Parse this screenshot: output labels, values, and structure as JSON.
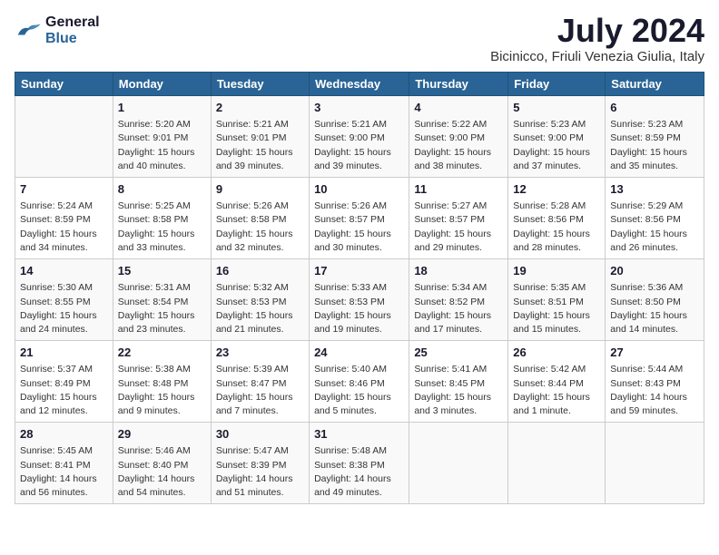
{
  "header": {
    "logo_line1": "General",
    "logo_line2": "Blue",
    "month": "July 2024",
    "location": "Bicinicco, Friuli Venezia Giulia, Italy"
  },
  "days_of_week": [
    "Sunday",
    "Monday",
    "Tuesday",
    "Wednesday",
    "Thursday",
    "Friday",
    "Saturday"
  ],
  "weeks": [
    [
      {
        "day": "",
        "info": ""
      },
      {
        "day": "1",
        "info": "Sunrise: 5:20 AM\nSunset: 9:01 PM\nDaylight: 15 hours\nand 40 minutes."
      },
      {
        "day": "2",
        "info": "Sunrise: 5:21 AM\nSunset: 9:01 PM\nDaylight: 15 hours\nand 39 minutes."
      },
      {
        "day": "3",
        "info": "Sunrise: 5:21 AM\nSunset: 9:00 PM\nDaylight: 15 hours\nand 39 minutes."
      },
      {
        "day": "4",
        "info": "Sunrise: 5:22 AM\nSunset: 9:00 PM\nDaylight: 15 hours\nand 38 minutes."
      },
      {
        "day": "5",
        "info": "Sunrise: 5:23 AM\nSunset: 9:00 PM\nDaylight: 15 hours\nand 37 minutes."
      },
      {
        "day": "6",
        "info": "Sunrise: 5:23 AM\nSunset: 8:59 PM\nDaylight: 15 hours\nand 35 minutes."
      }
    ],
    [
      {
        "day": "7",
        "info": "Sunrise: 5:24 AM\nSunset: 8:59 PM\nDaylight: 15 hours\nand 34 minutes."
      },
      {
        "day": "8",
        "info": "Sunrise: 5:25 AM\nSunset: 8:58 PM\nDaylight: 15 hours\nand 33 minutes."
      },
      {
        "day": "9",
        "info": "Sunrise: 5:26 AM\nSunset: 8:58 PM\nDaylight: 15 hours\nand 32 minutes."
      },
      {
        "day": "10",
        "info": "Sunrise: 5:26 AM\nSunset: 8:57 PM\nDaylight: 15 hours\nand 30 minutes."
      },
      {
        "day": "11",
        "info": "Sunrise: 5:27 AM\nSunset: 8:57 PM\nDaylight: 15 hours\nand 29 minutes."
      },
      {
        "day": "12",
        "info": "Sunrise: 5:28 AM\nSunset: 8:56 PM\nDaylight: 15 hours\nand 28 minutes."
      },
      {
        "day": "13",
        "info": "Sunrise: 5:29 AM\nSunset: 8:56 PM\nDaylight: 15 hours\nand 26 minutes."
      }
    ],
    [
      {
        "day": "14",
        "info": "Sunrise: 5:30 AM\nSunset: 8:55 PM\nDaylight: 15 hours\nand 24 minutes."
      },
      {
        "day": "15",
        "info": "Sunrise: 5:31 AM\nSunset: 8:54 PM\nDaylight: 15 hours\nand 23 minutes."
      },
      {
        "day": "16",
        "info": "Sunrise: 5:32 AM\nSunset: 8:53 PM\nDaylight: 15 hours\nand 21 minutes."
      },
      {
        "day": "17",
        "info": "Sunrise: 5:33 AM\nSunset: 8:53 PM\nDaylight: 15 hours\nand 19 minutes."
      },
      {
        "day": "18",
        "info": "Sunrise: 5:34 AM\nSunset: 8:52 PM\nDaylight: 15 hours\nand 17 minutes."
      },
      {
        "day": "19",
        "info": "Sunrise: 5:35 AM\nSunset: 8:51 PM\nDaylight: 15 hours\nand 15 minutes."
      },
      {
        "day": "20",
        "info": "Sunrise: 5:36 AM\nSunset: 8:50 PM\nDaylight: 15 hours\nand 14 minutes."
      }
    ],
    [
      {
        "day": "21",
        "info": "Sunrise: 5:37 AM\nSunset: 8:49 PM\nDaylight: 15 hours\nand 12 minutes."
      },
      {
        "day": "22",
        "info": "Sunrise: 5:38 AM\nSunset: 8:48 PM\nDaylight: 15 hours\nand 9 minutes."
      },
      {
        "day": "23",
        "info": "Sunrise: 5:39 AM\nSunset: 8:47 PM\nDaylight: 15 hours\nand 7 minutes."
      },
      {
        "day": "24",
        "info": "Sunrise: 5:40 AM\nSunset: 8:46 PM\nDaylight: 15 hours\nand 5 minutes."
      },
      {
        "day": "25",
        "info": "Sunrise: 5:41 AM\nSunset: 8:45 PM\nDaylight: 15 hours\nand 3 minutes."
      },
      {
        "day": "26",
        "info": "Sunrise: 5:42 AM\nSunset: 8:44 PM\nDaylight: 15 hours\nand 1 minute."
      },
      {
        "day": "27",
        "info": "Sunrise: 5:44 AM\nSunset: 8:43 PM\nDaylight: 14 hours\nand 59 minutes."
      }
    ],
    [
      {
        "day": "28",
        "info": "Sunrise: 5:45 AM\nSunset: 8:41 PM\nDaylight: 14 hours\nand 56 minutes."
      },
      {
        "day": "29",
        "info": "Sunrise: 5:46 AM\nSunset: 8:40 PM\nDaylight: 14 hours\nand 54 minutes."
      },
      {
        "day": "30",
        "info": "Sunrise: 5:47 AM\nSunset: 8:39 PM\nDaylight: 14 hours\nand 51 minutes."
      },
      {
        "day": "31",
        "info": "Sunrise: 5:48 AM\nSunset: 8:38 PM\nDaylight: 14 hours\nand 49 minutes."
      },
      {
        "day": "",
        "info": ""
      },
      {
        "day": "",
        "info": ""
      },
      {
        "day": "",
        "info": ""
      }
    ]
  ]
}
